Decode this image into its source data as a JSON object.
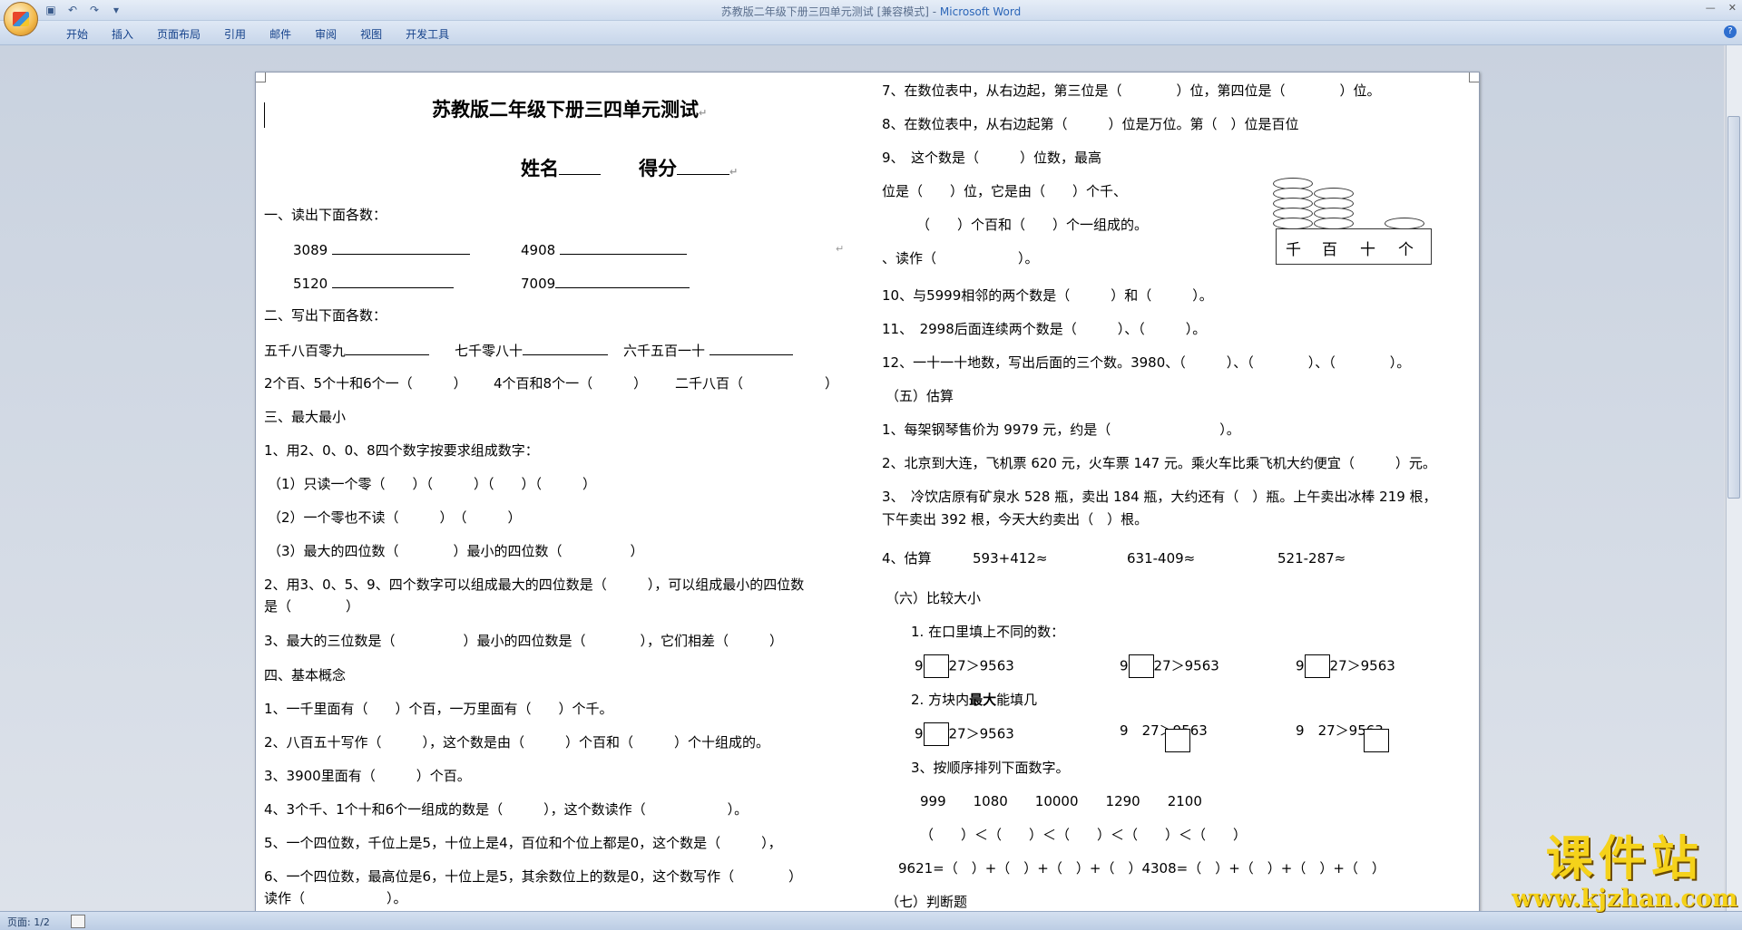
{
  "window": {
    "title": "苏教版二年级下册三四单元测试 [兼容模式] - ",
    "app_name": "Microsoft Word",
    "minimize_icon": "minimize-icon",
    "close_icon": "close-icon"
  },
  "ribbon": {
    "tabs": [
      "开始",
      "插入",
      "页面布局",
      "引用",
      "邮件",
      "审阅",
      "视图",
      "开发工具"
    ]
  },
  "status": {
    "page": "页面: 1/2"
  },
  "doc": {
    "title": "苏教版二年级下册三四单元测试",
    "name_label": "姓名",
    "score_label": "得分",
    "s1": "一、读出下面各数：",
    "n1": "3089",
    "n2": "4908",
    "n3": "5120",
    "n4": "7009",
    "s2": "二、写出下面各数：",
    "w1": "五千八百零九",
    "w2": "七千零八十",
    "w3": "六千五百一十",
    "w4": "2个百、5个十和6个一（　　　）",
    "w5": "4个百和8个一（　　　）",
    "w6": "二千八百（　　　　　　）",
    "s3": "三、最大最小",
    "q3_1": "1、用2、0、0、8四个数字按要求组成数字：",
    "q3_1a": "（1）只读一个零（　　）（　　　）（　　）（　　　）",
    "q3_1b": "（2）一个零也不读（　　　）　（　　　）",
    "q3_1c": "（3）最大的四位数（　　　　）最小的四位数（　　　　　）",
    "q3_2a": "2、用3、0、5、9、四个数字可以组成最大的四位数是（　　　），可以组成最小的四位数",
    "q3_2b": "是（　　　　）",
    "q3_3": "3、最大的三位数是（　　　　　）最小的四位数是（　　　　），它们相差（　　　）",
    "s4": "四、基本概念",
    "q4_1": "1、一千里面有（　　）个百，一万里面有（　　）个千。",
    "q4_2": "2、八百五十写作（　　　），这个数是由（　　　）个百和（　　　）个十组成的。",
    "q4_3": "3、3900里面有（　　　）个百。",
    "q4_4": "4、3个千、1个十和6个一组成的数是（　　　），这个数读作（　　　　　　）。",
    "q4_5": "5、一个四位数，千位上是5，十位上是4，百位和个位上都是0，这个数是（　　　），",
    "q4_6a": "6、一个四位数，最高位是6，十位上是5，其余数位上的数是0，这个数写作（　　　　）",
    "q4_6b": "读作（　　　　　　）。",
    "r7": "7、在数位表中，从右边起，第三位是（　　　　）位，第四位是（　　　　）位。",
    "r8": "8、在数位表中，从右边起第（　　　）位是万位。第（　）位是百位",
    "r9a": "9、　这个数是（　　　）位数，最高",
    "r9b": "位是（　　）位，它是由（　　）个千、",
    "r9c": "（　　）个百和（　　）个一组成的。",
    "r9d": "、读作（　　　　　　）。",
    "abacus": [
      "千",
      "百",
      "十",
      "个"
    ],
    "r10": "10、与5999相邻的两个数是（　　　）和（　　　）。",
    "r11": "11、　2998后面连续两个数是（　　　）、（　　　）。",
    "r12": "12、一十一十地数，写出后面的三个数。3980、（　　　）、（　　　　）、（　　　　）。",
    "s5": "（五）估算",
    "e1": "1、每架钢琴售价为 9979 元，约是（　　　　　　　　）。",
    "e2": "2、北京到大连，飞机票 620 元，火车票 147 元。乘火车比乘飞机大约便宜（　　　）元。",
    "e3a": "3、　冷饮店原有矿泉水 528 瓶，卖出 184 瓶，大约还有（　）瓶。上午卖出冰棒 219 根，",
    "e3b": "下午卖出 392 根，今天大约卖出（　）根。",
    "e4_label": "4、估算",
    "e4_1": "593+412≈",
    "e4_2": "631-409≈",
    "e4_3": "521-287≈",
    "s6": "（六）比较大小",
    "c1": "1. 在口里填上不同的数：",
    "c1_a": [
      "9",
      "27＞9563"
    ],
    "c2": "2. 方块内",
    "c2_bold": "最大",
    "c2_tail": "能填几",
    "c3": "3、按顺序排列下面数字。",
    "c3_nums": "999　　1080　　10000　　1290　　2100",
    "c3_order": "（　　）＜（　　）＜（　　）＜（　　）＜（　　）",
    "c4": "9621=（　）+（　）+（　）+（　）4308=（　）+（　）+（　）+（　）",
    "s7": "（七）判断题"
  },
  "watermark": {
    "title": "课件站",
    "url": "www.kjzhan.com"
  }
}
